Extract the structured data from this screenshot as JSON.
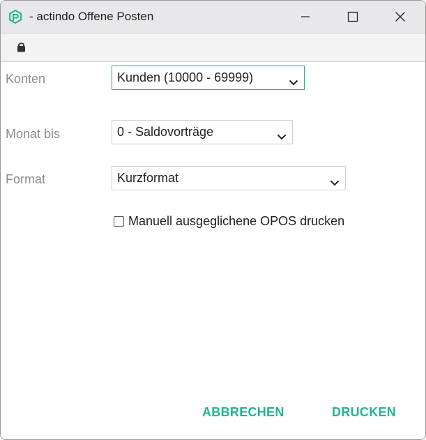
{
  "window": {
    "title": "- actindo Offene Posten",
    "controls": {
      "minimize": "minimize",
      "maximize": "maximize",
      "close": "close"
    }
  },
  "address_bar": {
    "icon": "lock-icon"
  },
  "form": {
    "konten": {
      "label": "Konten",
      "value": "Kunden (10000 - 69999)"
    },
    "monat_bis": {
      "label": "Monat bis",
      "value": "0 - Saldovorträge"
    },
    "format": {
      "label": "Format",
      "value": "Kurzformat"
    },
    "checkbox": {
      "label": "Manuell ausgeglichene OPOS drucken",
      "checked": false
    }
  },
  "actions": {
    "cancel": "ABBRECHEN",
    "print": "DRUCKEN"
  },
  "colors": {
    "accent": "#21b495",
    "focus_border": "#23a891",
    "label": "#8c8c8c"
  }
}
